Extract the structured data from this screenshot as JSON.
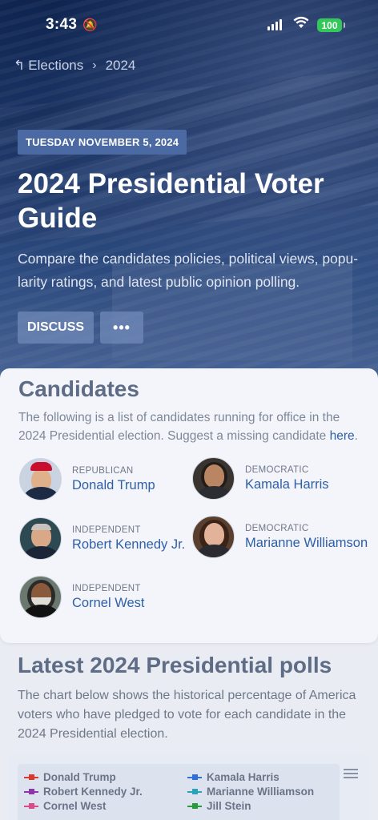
{
  "status": {
    "time": "3:43",
    "battery": "100"
  },
  "breadcrumb": {
    "back_label": "Elections",
    "current": "2024"
  },
  "hero": {
    "date": "TUESDAY NOVEMBER 5, 2024",
    "title": "2024 Presidential Voter Guide",
    "description": "Compare the candidates policies, political views, popu-larity ratings, and latest public opinion polling.",
    "discuss_label": "DISCUSS",
    "more_label": "•••"
  },
  "candidates": {
    "title": "Candidates",
    "description": "The following is a list of candidates running for office in the 2024 Presidential election. Suggest a missing candidate ",
    "link_text": "here",
    "link_suffix": ".",
    "items": [
      {
        "party": "REPUBLICAN",
        "name": "Donald Trump"
      },
      {
        "party": "DEMOCRATIC",
        "name": "Kamala Harris"
      },
      {
        "party": "INDEPENDENT",
        "name": "Robert Kennedy Jr."
      },
      {
        "party": "DEMOCRATIC",
        "name": "Marianne Williamson"
      },
      {
        "party": "INDEPENDENT",
        "name": "Cornel West"
      }
    ]
  },
  "polls": {
    "title": "Latest 2024 Presidential polls",
    "description": "The chart below shows the historical percentage of America voters who have pledged to vote for each candidate in the 2024 Presidential election.",
    "legend": [
      {
        "name": "Donald Trump",
        "color": "#d83a2e"
      },
      {
        "name": "Kamala Harris",
        "color": "#2f6fd6"
      },
      {
        "name": "Robert Kennedy Jr.",
        "color": "#8e35a8"
      },
      {
        "name": "Marianne Williamson",
        "color": "#2aa3b8"
      },
      {
        "name": "Cornel West",
        "color": "#d94c8a"
      },
      {
        "name": "Jill Stein",
        "color": "#2a9a3a"
      }
    ]
  }
}
